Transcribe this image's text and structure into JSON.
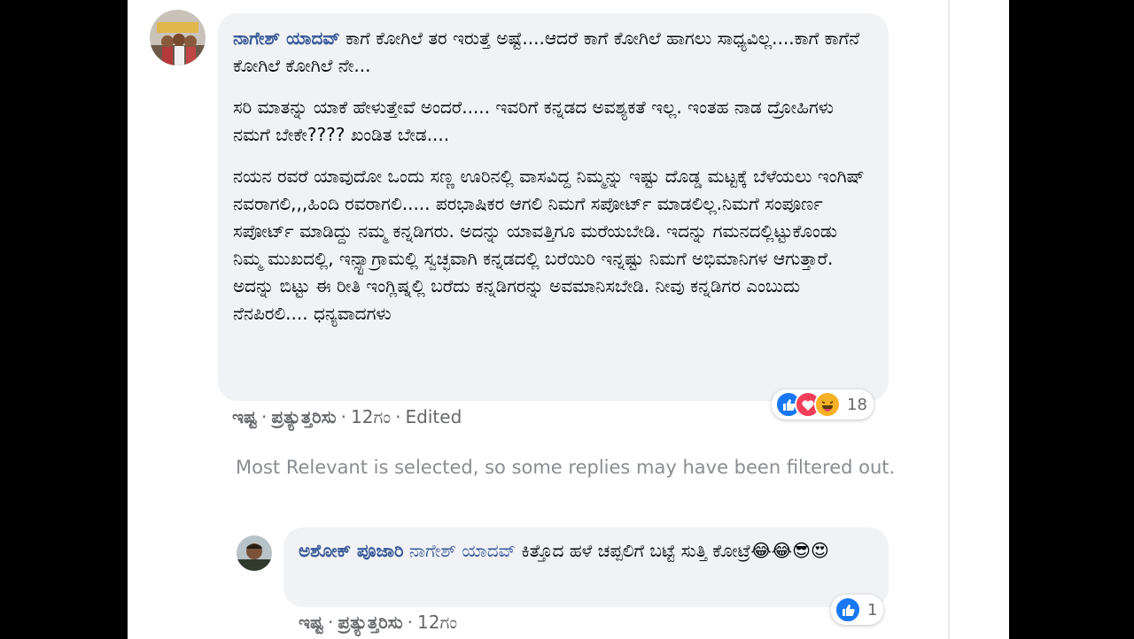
{
  "comment": {
    "author": "ನಾಗೇಶ್ ಯಾದವ್",
    "paragraphs": [
      "ಕಾಗೆ ಕೋಗಿಲೆ ತರ ಇರುತ್ತೆ ಅಷ್ಟೆ....ಆದರೆ ಕಾಗೆ ಕೋಗಿಲೆ ಹಾಗಲು ಸಾಧ್ಯವಿಲ್ಲ....ಕಾಗೆ ಕಾಗೆನೆ ಕೋಗಿಲೆ ಕೋಗಿಲೆ ನೇ...",
      "ಸರಿ ಮಾತನ್ನು ಯಾಕೆ ಹೇಳುತ್ತೇವೆ ಅಂದರೆ..... ಇವರಿಗೆ ಕನ್ನಡದ ಅವಶ್ಯಕತೆ ಇಲ್ಲ. ಇಂತಹ ನಾಡ ದ್ರೋಹಿಗಳು ನಮಗೆ ಬೇಕೇ???? ಖಂಡಿತ ಬೇಡ....",
      "ನಯನ ರವರೆ ಯಾವುದೋ ಒಂದು ಸಣ್ಣ ಊರಿನಲ್ಲಿ ವಾಸವಿದ್ದ ನಿಮ್ಮನ್ನು ಇಷ್ಟು ದೊಡ್ಡ ಮಟ್ಟಕ್ಕೆ ಬೆಳೆಯಲು ಇಂಗಿಷ್ ನವರಾಗಲಿ,,,ಹಿಂದಿ ರವರಾಗಲಿ..... ಪರಭಾಷಿಕರ ಆಗಲಿ ನಿಮಗೆ ಸಪೋರ್ಟ್ ಮಾಡಲಿಲ್ಲ.ನಿಮಗೆ ಸಂಪೂರ್ಣ ಸಪೋರ್ಟ್ ಮಾಡಿದ್ದು ನಮ್ಮ ಕನ್ನಡಿಗರು. ಅದನ್ನು ಯಾವತ್ತಿಗೂ ಮರೆಯಬೇಡಿ. ಇದನ್ನು ಗಮನದಲ್ಲಿಟ್ಟುಕೊಂಡು ನಿಮ್ಮ ಮುಖದಲ್ಲಿ, ಇನ್ಸ್ಟಾಗ್ರಾಮಲ್ಲಿ ಸ್ವಚ್ಛವಾಗಿ ಕನ್ನಡದಲ್ಲಿ ಬರೆಯಿರಿ ಇನ್ನಷ್ಟು ನಿಮಗೆ ಅಭಿಮಾನಿಗಳ ಆಗುತ್ತಾರೆ. ಅದನ್ನು ಬಿಟ್ಟು ಈ ರೀತಿ ಇಂಗ್ಲಿಷ್ನಲ್ಲಿ ಬರೆದು ಕನ್ನಡಿಗರನ್ನು ಅವಮಾನಿಸಬೇಡಿ. ನೀವು ಕನ್ನಡಿಗರ ಎಂಬುದು ನೆನಪಿರಲಿ.... ಧನ್ಯವಾದಗಳು"
    ],
    "actions": {
      "like": "ಇಷ್ಟ",
      "reply": "ಪ್ರತ್ಯುತ್ತರಿಸು",
      "time": "12ಗಂ",
      "edited": "Edited"
    },
    "reactions": {
      "types": [
        "like-icon",
        "love-icon",
        "haha-icon"
      ],
      "count": "18"
    }
  },
  "filter_notice": "Most Relevant is selected, so some replies may have been filtered out.",
  "reply": {
    "author": "ಅಶೋಕ್ ಪೂಜಾರಿ",
    "mention": "ನಾಗೇಶ್ ಯಾದವ್",
    "text": "ಕಿತ್ತೊದ ಹಳೆ ಚಪ್ಪಲಿಗೆ ಬಟ್ಟೆ ಸುತ್ತಿ ಕೋಟ್ರೆ",
    "emojis": [
      "😂",
      "😂",
      "😎",
      "😍"
    ],
    "actions": {
      "like": "ಇಷ್ಟ",
      "reply": "ಪ್ರತ್ಯುತ್ತರಿಸು",
      "time": "12ಗಂ"
    },
    "reactions": {
      "types": [
        "like-icon"
      ],
      "count": "1"
    }
  },
  "colors": {
    "author": "#385898",
    "bubble": "#f0f2f5",
    "like": "#1877f2",
    "love": "#f33e58",
    "haha": "#f7b125",
    "meta": "#65676b"
  }
}
